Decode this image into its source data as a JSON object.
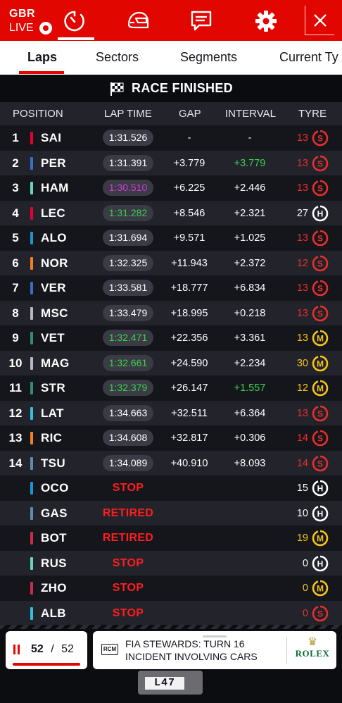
{
  "header": {
    "country": "GBR",
    "live_label": "LIVE",
    "icons": [
      "timer-icon",
      "helmet-icon",
      "chat-icon",
      "gear-icon",
      "close-icon"
    ],
    "active_icon": "timer-icon"
  },
  "tabs": [
    {
      "label": "Laps",
      "active": true
    },
    {
      "label": "Sectors",
      "active": false
    },
    {
      "label": "Segments",
      "active": false
    },
    {
      "label": "Current Ty",
      "active": false
    }
  ],
  "banner": {
    "text": "RACE FINISHED",
    "icon": "chequered-flag-icon"
  },
  "columns": {
    "position": "POSITION",
    "lap_time": "LAP TIME",
    "gap": "GAP",
    "interval": "INTERVAL",
    "tyre": "TYRE"
  },
  "colors": {
    "accent": "#e10600",
    "purple": "#d43ad8",
    "green": "#3ed04f",
    "soft": "#e8302a",
    "medium": "#f5c518",
    "hard": "#ffffff",
    "stop": "#ff1e1e"
  },
  "rows": [
    {
      "pos": "1",
      "drv": "SAI",
      "team": "#e8002d",
      "lap": "1:31.526",
      "lap_color": "white",
      "status": "",
      "gap": "-",
      "int": "-",
      "int_color": "white",
      "laps": "13",
      "tyre": "S"
    },
    {
      "pos": "2",
      "drv": "PER",
      "team": "#3671c6",
      "lap": "1:31.391",
      "lap_color": "white",
      "status": "",
      "gap": "+3.779",
      "int": "+3.779",
      "int_color": "green",
      "laps": "13",
      "tyre": "S"
    },
    {
      "pos": "3",
      "drv": "HAM",
      "team": "#6cd3bf",
      "lap": "1:30.510",
      "lap_color": "purple",
      "status": "",
      "gap": "+6.225",
      "int": "+2.446",
      "int_color": "white",
      "laps": "13",
      "tyre": "S"
    },
    {
      "pos": "4",
      "drv": "LEC",
      "team": "#e8002d",
      "lap": "1:31.282",
      "lap_color": "green",
      "status": "",
      "gap": "+8.546",
      "int": "+2.321",
      "int_color": "white",
      "laps": "27",
      "tyre": "H"
    },
    {
      "pos": "5",
      "drv": "ALO",
      "team": "#2293d1",
      "lap": "1:31.694",
      "lap_color": "white",
      "status": "",
      "gap": "+9.571",
      "int": "+1.025",
      "int_color": "white",
      "laps": "13",
      "tyre": "S"
    },
    {
      "pos": "6",
      "drv": "NOR",
      "team": "#f58020",
      "lap": "1:32.325",
      "lap_color": "white",
      "status": "",
      "gap": "+11.943",
      "int": "+2.372",
      "int_color": "white",
      "laps": "12",
      "tyre": "S"
    },
    {
      "pos": "7",
      "drv": "VER",
      "team": "#3671c6",
      "lap": "1:33.581",
      "lap_color": "white",
      "status": "",
      "gap": "+18.777",
      "int": "+6.834",
      "int_color": "white",
      "laps": "13",
      "tyre": "S"
    },
    {
      "pos": "8",
      "drv": "MSC",
      "team": "#b6babd",
      "lap": "1:33.479",
      "lap_color": "white",
      "status": "",
      "gap": "+18.995",
      "int": "+0.218",
      "int_color": "white",
      "laps": "13",
      "tyre": "S"
    },
    {
      "pos": "9",
      "drv": "VET",
      "team": "#358c75",
      "lap": "1:32.471",
      "lap_color": "green",
      "status": "",
      "gap": "+22.356",
      "int": "+3.361",
      "int_color": "white",
      "laps": "13",
      "tyre": "M"
    },
    {
      "pos": "10",
      "drv": "MAG",
      "team": "#b6babd",
      "lap": "1:32.661",
      "lap_color": "green",
      "status": "",
      "gap": "+24.590",
      "int": "+2.234",
      "int_color": "white",
      "laps": "30",
      "tyre": "M"
    },
    {
      "pos": "11",
      "drv": "STR",
      "team": "#358c75",
      "lap": "1:32.379",
      "lap_color": "green",
      "status": "",
      "gap": "+26.147",
      "int": "+1.557",
      "int_color": "green",
      "laps": "12",
      "tyre": "M"
    },
    {
      "pos": "12",
      "drv": "LAT",
      "team": "#37bedd",
      "lap": "1:34.663",
      "lap_color": "white",
      "status": "",
      "gap": "+32.511",
      "int": "+6.364",
      "int_color": "white",
      "laps": "13",
      "tyre": "S"
    },
    {
      "pos": "13",
      "drv": "RIC",
      "team": "#f58020",
      "lap": "1:34.608",
      "lap_color": "white",
      "status": "",
      "gap": "+32.817",
      "int": "+0.306",
      "int_color": "white",
      "laps": "14",
      "tyre": "S"
    },
    {
      "pos": "14",
      "drv": "TSU",
      "team": "#5e8faa",
      "lap": "1:34.089",
      "lap_color": "white",
      "status": "",
      "gap": "+40.910",
      "int": "+8.093",
      "int_color": "white",
      "laps": "14",
      "tyre": "S"
    },
    {
      "pos": "",
      "drv": "OCO",
      "team": "#2293d1",
      "lap": "",
      "lap_color": "white",
      "status": "STOP",
      "gap": "",
      "int": "",
      "int_color": "white",
      "laps": "15",
      "tyre": "H"
    },
    {
      "pos": "",
      "drv": "GAS",
      "team": "#5e8faa",
      "lap": "",
      "lap_color": "white",
      "status": "RETIRED",
      "gap": "",
      "int": "",
      "int_color": "white",
      "laps": "10",
      "tyre": "H"
    },
    {
      "pos": "",
      "drv": "BOT",
      "team": "#c92d4b",
      "lap": "",
      "lap_color": "white",
      "status": "RETIRED",
      "gap": "",
      "int": "",
      "int_color": "white",
      "laps": "19",
      "tyre": "M"
    },
    {
      "pos": "",
      "drv": "RUS",
      "team": "#6cd3bf",
      "lap": "",
      "lap_color": "white",
      "status": "STOP",
      "gap": "",
      "int": "",
      "int_color": "white",
      "laps": "0",
      "tyre": "H"
    },
    {
      "pos": "",
      "drv": "ZHO",
      "team": "#c92d4b",
      "lap": "",
      "lap_color": "white",
      "status": "STOP",
      "gap": "",
      "int": "",
      "int_color": "white",
      "laps": "0",
      "tyre": "M"
    },
    {
      "pos": "",
      "drv": "ALB",
      "team": "#37bedd",
      "lap": "",
      "lap_color": "white",
      "status": "STOP",
      "gap": "",
      "int": "",
      "int_color": "white",
      "laps": "0",
      "tyre": "S"
    }
  ],
  "footer": {
    "lap_current": "52",
    "lap_sep": "/",
    "lap_total": "52",
    "lap_progress": 1.0,
    "rcm_label": "RCM",
    "rcm_line1": "FIA STEWARDS: TURN 16",
    "rcm_line2": "INCIDENT INVOLVING CARS",
    "sponsor": "ROLEX",
    "car_plate": "L47"
  }
}
